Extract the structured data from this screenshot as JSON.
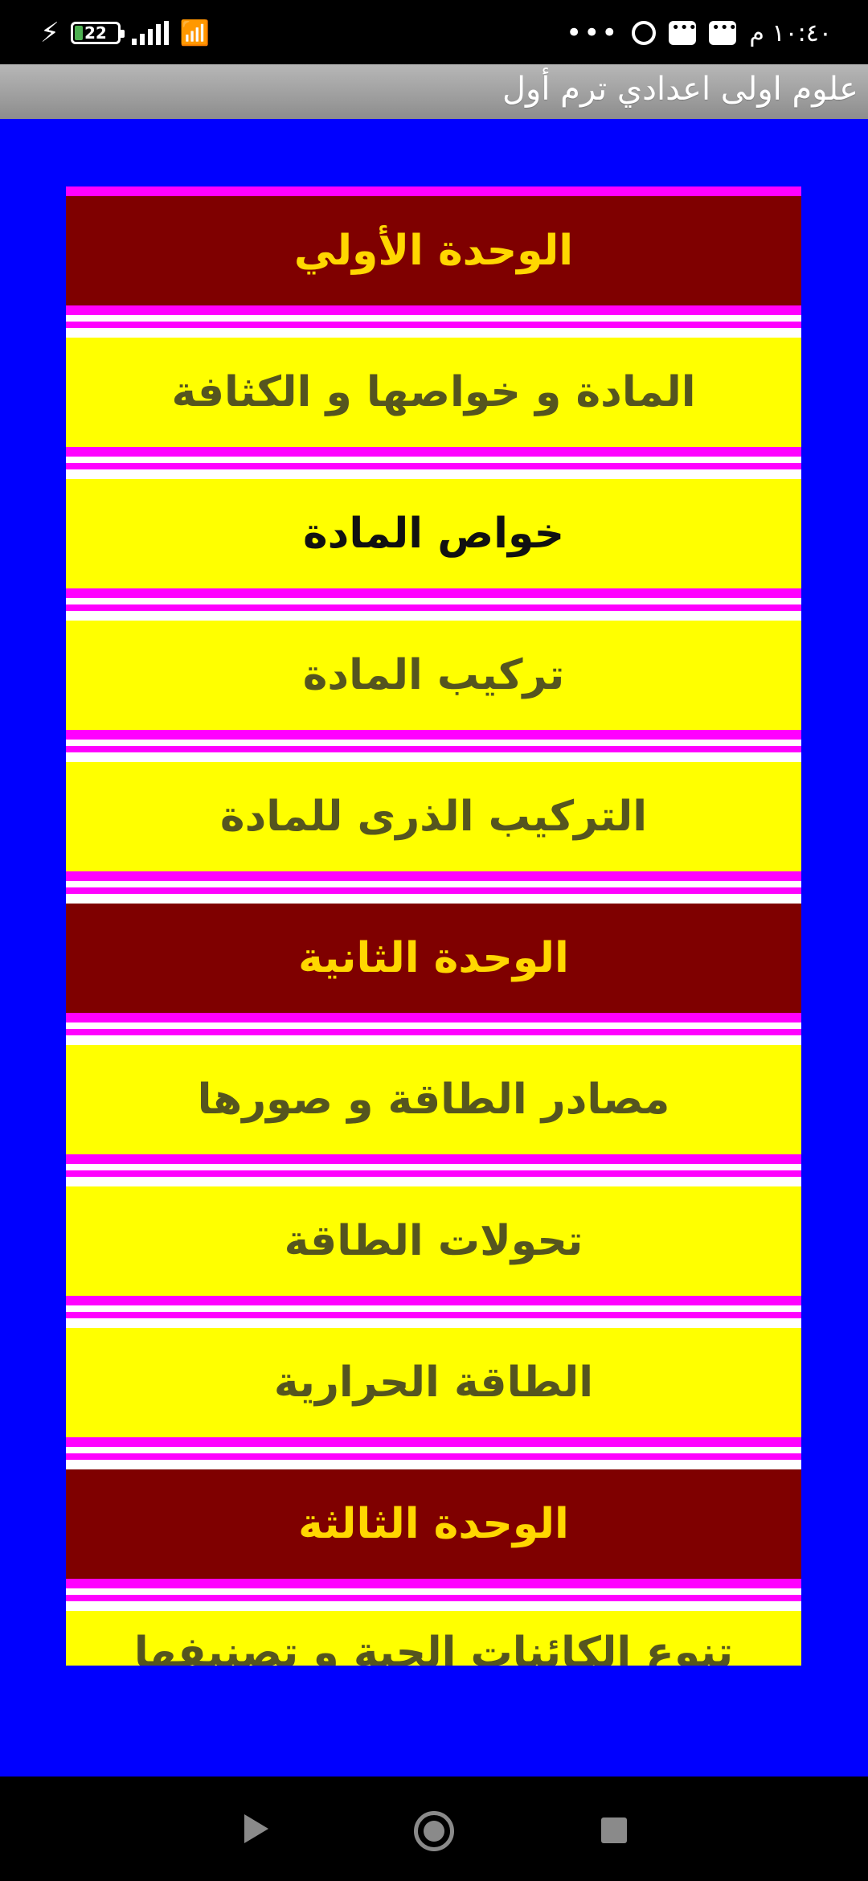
{
  "status_bar": {
    "battery": "22",
    "time": "١٠:٤٠ م",
    "more": "•••"
  },
  "app_bar": {
    "title": "علوم اولى اعدادي ترم أول"
  },
  "list": {
    "items": [
      {
        "label": "الوحدة الأولي",
        "type": "unit"
      },
      {
        "label": "المادة و خواصها و الكثافة",
        "type": "lesson"
      },
      {
        "label": "خواص المادة",
        "type": "lesson"
      },
      {
        "label": "تركيب المادة",
        "type": "lesson"
      },
      {
        "label": "التركيب الذرى للمادة",
        "type": "lesson"
      },
      {
        "label": "الوحدة الثانية",
        "type": "unit"
      },
      {
        "label": "مصادر الطاقة و صورها",
        "type": "lesson"
      },
      {
        "label": "تحولات الطاقة",
        "type": "lesson"
      },
      {
        "label": "الطاقة الحرارية",
        "type": "lesson"
      },
      {
        "label": "الوحدة الثالثة",
        "type": "unit"
      },
      {
        "label": "تنوع الكائنات الحية و تصنيفها",
        "type": "lesson"
      }
    ]
  }
}
